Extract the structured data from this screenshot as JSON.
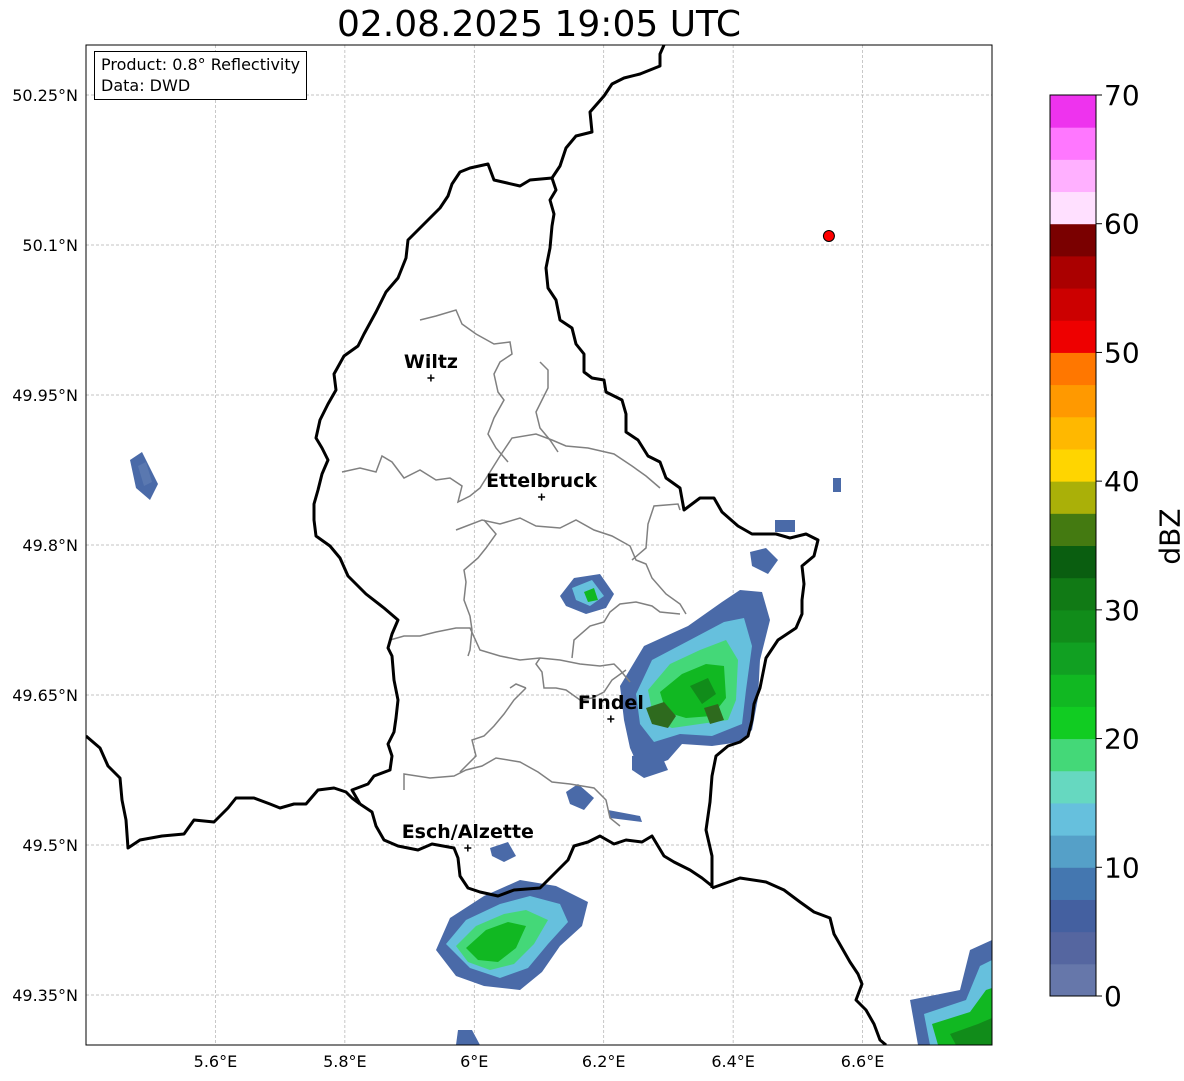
{
  "title": "02.08.2025 19:05 UTC",
  "info": {
    "product": "Product: 0.8° Reflectivity",
    "data": "Data: DWD"
  },
  "axes": {
    "x_ticks": [
      "5.6°E",
      "5.8°E",
      "6°E",
      "6.2°E",
      "6.4°E",
      "6.6°E"
    ],
    "x_tick_values": [
      5.6,
      5.8,
      6.0,
      6.2,
      6.4,
      6.6
    ],
    "y_ticks": [
      "50.25°N",
      "50.1°N",
      "49.95°N",
      "49.8°N",
      "49.65°N",
      "49.5°N",
      "49.35°N"
    ],
    "y_tick_values": [
      50.25,
      50.1,
      49.95,
      49.8,
      49.65,
      49.5,
      49.35
    ],
    "lon_range": [
      5.4,
      6.8
    ],
    "lat_range": [
      49.3,
      50.3
    ],
    "grid": true
  },
  "cities": [
    {
      "name": "Wiltz",
      "lon": 5.933,
      "lat": 49.967
    },
    {
      "name": "Ettelbruck",
      "lon": 6.104,
      "lat": 49.848
    },
    {
      "name": "Findel",
      "lon": 6.211,
      "lat": 49.626
    },
    {
      "name": "Esch/Alzette",
      "lon": 5.99,
      "lat": 49.497
    }
  ],
  "radar_site": {
    "lon": 6.548,
    "lat": 50.109,
    "color": "#ff0000"
  },
  "colorbar": {
    "label": "dBZ",
    "min": 0,
    "max": 70,
    "tick_labels": [
      "0",
      "10",
      "20",
      "30",
      "40",
      "50",
      "60",
      "70"
    ],
    "colors": [
      "#6677aa",
      "#5566a0",
      "#4460a0",
      "#4477b0",
      "#55a0c8",
      "#66c0dd",
      "#66d8c0",
      "#44d878",
      "#11cc22",
      "#11b822",
      "#11a022",
      "#118c1a",
      "#117a15",
      "#0a5e10",
      "#447a11",
      "#aab008",
      "#ffd500",
      "#ffb800",
      "#ff9900",
      "#ff7700",
      "#ee0000",
      "#cc0000",
      "#aa0000",
      "#7a0000",
      "#ffe0ff",
      "#ffb0ff",
      "#ff77ff",
      "#ee33ee"
    ]
  },
  "colors": {
    "border": "#000000",
    "canton": "#808080",
    "grid": "#b0b0b0"
  }
}
